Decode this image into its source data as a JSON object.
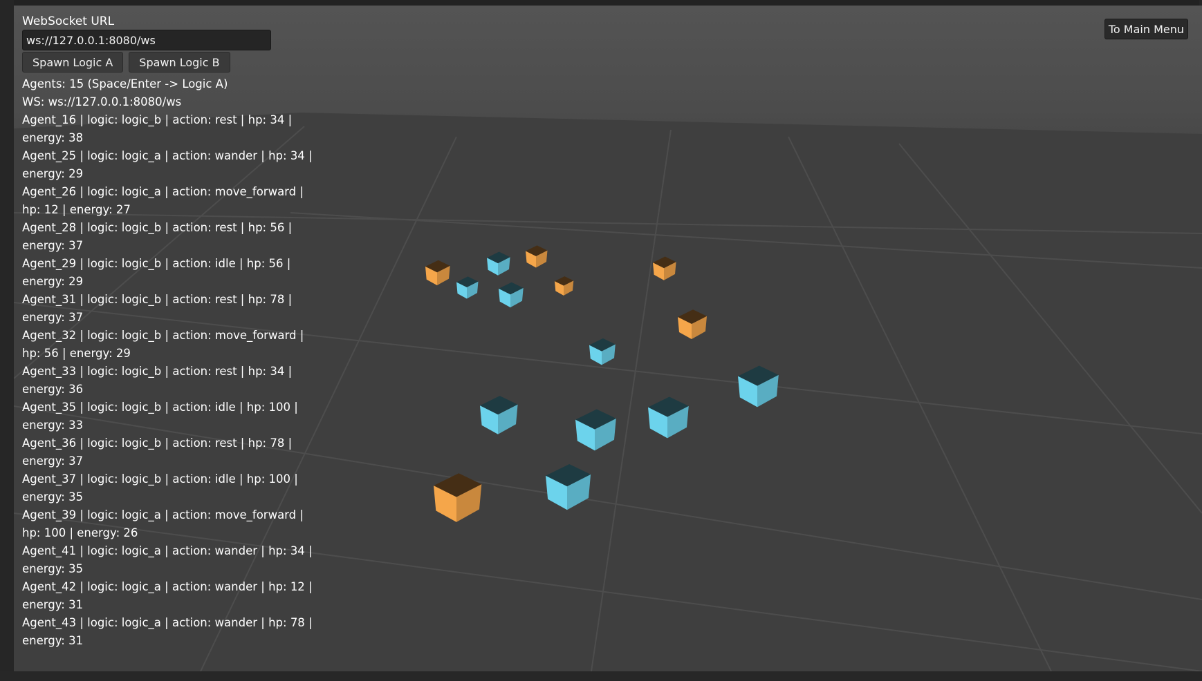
{
  "connection": {
    "label": "WebSocket URL",
    "url_value": "ws://127.0.0.1:8080/ws"
  },
  "buttons": {
    "spawn_a": "Spawn Logic A",
    "spawn_b": "Spawn Logic B",
    "main_menu": "To Main Menu"
  },
  "status": {
    "agents_line": "Agents: 15 (Space/Enter -> Logic A)",
    "ws_line": "WS: ws://127.0.0.1:8080/ws"
  },
  "agents": [
    "Agent_16 | logic: logic_b | action: rest | hp: 34 | energy: 38",
    "Agent_25 | logic: logic_a | action: wander | hp: 34 | energy: 29",
    "Agent_26 | logic: logic_a | action: move_forward | hp: 12 | energy: 27",
    "Agent_28 | logic: logic_b | action: rest | hp: 56 | energy: 37",
    "Agent_29 | logic: logic_b | action: idle | hp: 56 | energy: 29",
    "Agent_31 | logic: logic_b | action: rest | hp: 78 | energy: 37",
    "Agent_32 | logic: logic_b | action: move_forward | hp: 56 | energy: 29",
    "Agent_33 | logic: logic_b | action: rest | hp: 34 | energy: 36",
    "Agent_35 | logic: logic_b | action: idle | hp: 100 | energy: 33",
    "Agent_36 | logic: logic_b | action: rest | hp: 78 | energy: 37",
    "Agent_37 | logic: logic_b | action: idle | hp: 100 | energy: 35",
    "Agent_39 | logic: logic_a | action: move_forward | hp: 100 | energy: 26",
    "Agent_41 | logic: logic_a | action: wander | hp: 34 | energy: 35",
    "Agent_42 | logic: logic_a | action: wander | hp: 12 | energy: 31",
    "Agent_43 | logic: logic_a | action: wander | hp: 78 | energy: 31"
  ],
  "colors": {
    "logic_a_cube": "#f5a64a",
    "logic_b_cube": "#6cd3ec",
    "ground": "#3d3d3d",
    "grid_line": "#4a4a4a"
  },
  "icons": {
    "agent_a": "orange-cube-icon",
    "agent_b": "cyan-cube-icon"
  }
}
